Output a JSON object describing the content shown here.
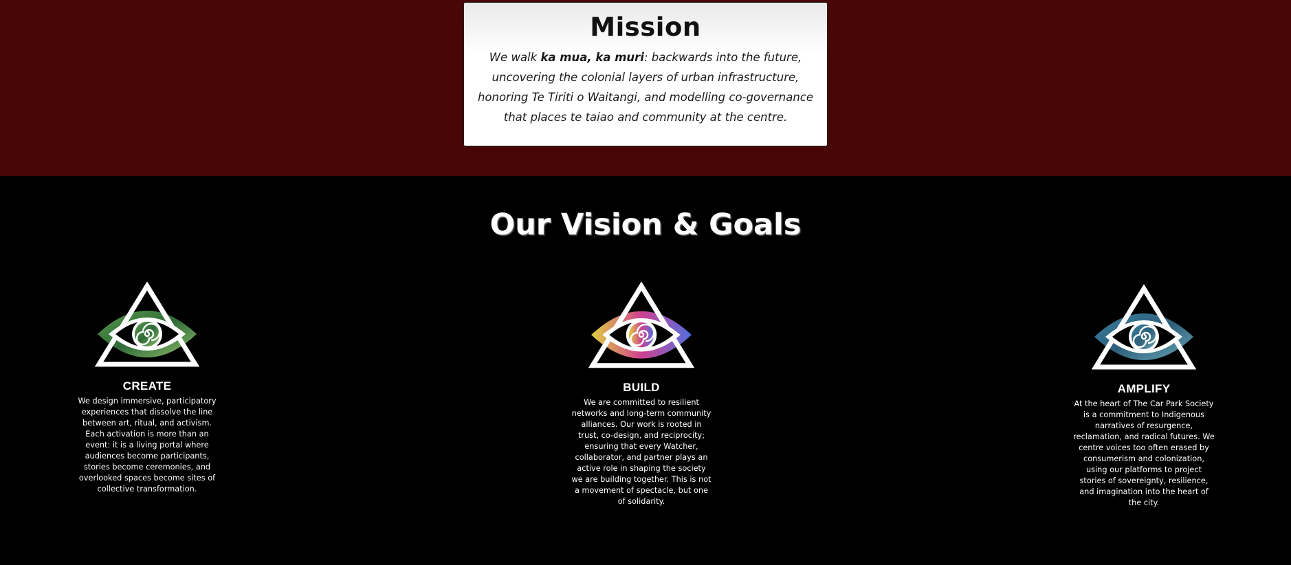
{
  "mission": {
    "title": "Mission",
    "text_before": "We walk ",
    "text_bold": "ka mua, ka muri",
    "text_after": ": backwards into the future, uncovering the colonial layers of urban infrastructure, honoring Te Tiriti o Waitangi, and modelling co-governance that places te taiao and community at the centre."
  },
  "vision": {
    "title": "Our Vision & Goals",
    "goals": [
      {
        "title": "CREATE",
        "icon": "eye-triangle-icon",
        "colors": [
          "#5a9a4a",
          "#2f6b3a",
          "#8fbf6a"
        ],
        "text": "We design immersive, participatory experiences that dissolve the line between art, ritual, and activism. Each activation is more than an event: it is a living portal where audiences become participants, stories become ceremonies, and overlooked spaces become sites of collective transformation."
      },
      {
        "title": "BUILD",
        "icon": "eye-triangle-icon",
        "colors": [
          "#e0d040",
          "#d04090",
          "#5070e0"
        ],
        "text": "We are committed to resilient networks and long-term community alliances. Our work is rooted in trust, co-design, and reciprocity; ensuring that every Watcher, collaborator, and partner plays an active role in shaping the society we are building together. This is not a movement of spectacle, but one of solidarity."
      },
      {
        "title": "AMPLIFY",
        "icon": "eye-triangle-icon",
        "colors": [
          "#3a7fa0",
          "#2d5f7a",
          "#6aa7b8"
        ],
        "text": "At the heart of The Car Park Society is a commitment to Indigenous narratives of resurgence, reclamation, and radical futures. We centre voices too often erased by consumerism and colonization, using our platforms to project stories of sovereignty, resilience, and imagination into the heart of the city."
      }
    ]
  },
  "colors": {
    "top_band": "#480606",
    "background": "#000000"
  }
}
